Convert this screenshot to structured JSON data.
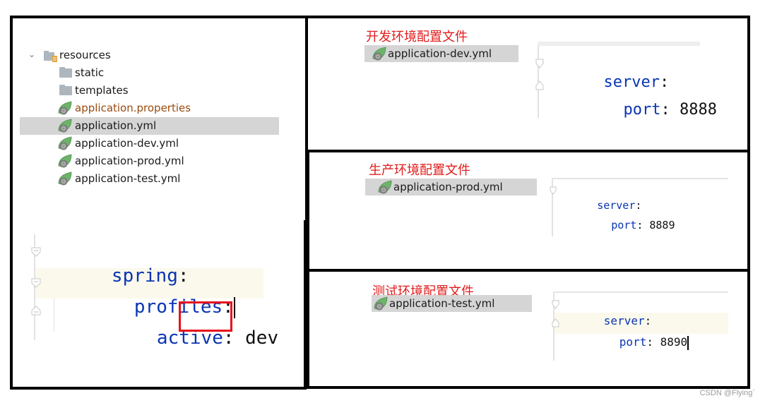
{
  "project_tree": {
    "root": {
      "label": "resources",
      "expanded": true
    },
    "items": [
      {
        "label": "static",
        "type": "folder",
        "selected": false
      },
      {
        "label": "templates",
        "type": "folder",
        "selected": false
      },
      {
        "label": "application.properties",
        "type": "spring-config",
        "selected": false,
        "modified": true
      },
      {
        "label": "application.yml",
        "type": "spring-config",
        "selected": true
      },
      {
        "label": "application-dev.yml",
        "type": "spring-config",
        "selected": false
      },
      {
        "label": "application-prod.yml",
        "type": "spring-config",
        "selected": false
      },
      {
        "label": "application-test.yml",
        "type": "spring-config",
        "selected": false
      }
    ]
  },
  "main_yaml": {
    "lines": [
      {
        "key": "spring",
        "colon": ":"
      },
      {
        "key": "profiles",
        "colon": ":"
      },
      {
        "key": "active",
        "colon": ": ",
        "value": "dev"
      }
    ],
    "highlight_color": "#e8101c"
  },
  "profiles": [
    {
      "caption": "开发环境配置文件",
      "file": "application-dev.yml",
      "lines": [
        {
          "key": "server",
          "colon": ":"
        },
        {
          "key": "port",
          "colon": ": ",
          "value": "8888"
        }
      ]
    },
    {
      "caption": "生产环境配置文件",
      "file": "application-prod.yml",
      "lines": [
        {
          "key": "server",
          "colon": ":"
        },
        {
          "key": "port",
          "colon": ": ",
          "value": "8889"
        }
      ]
    },
    {
      "caption": "测试环境配置文件",
      "file": "application-test.yml",
      "lines": [
        {
          "key": "server",
          "colon": ":"
        },
        {
          "key": "port",
          "colon": ": ",
          "value": "8890"
        }
      ]
    }
  ],
  "colors": {
    "caption": "#e31b1b",
    "yaml_key": "#0a35b3",
    "selection": "#d5d5d5",
    "properties_file": "#9b4a10"
  },
  "watermark": "CSDN @Flying`"
}
